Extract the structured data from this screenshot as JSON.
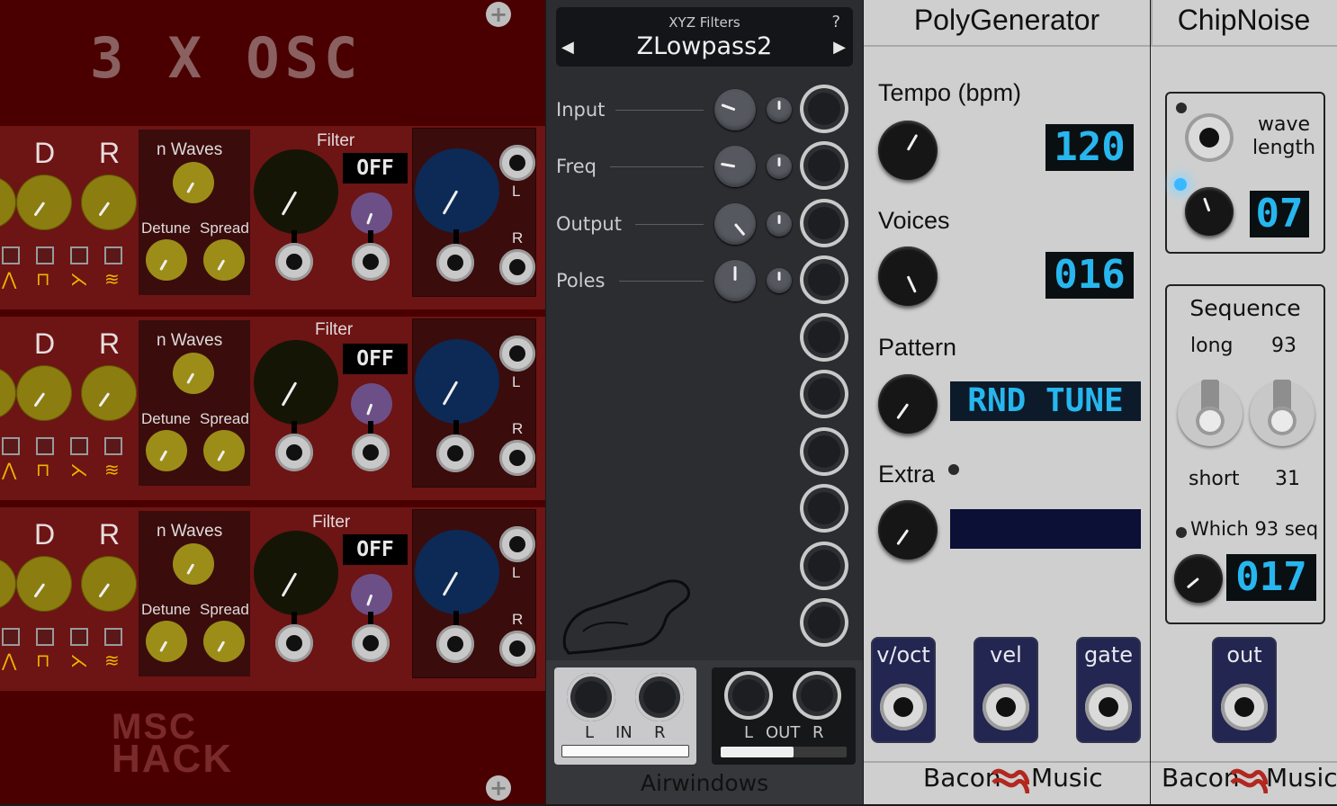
{
  "msc_hack": {
    "title": "3 X OSC",
    "brand_line1": "MSC",
    "brand_line2": "HACK",
    "screw_symbol": "+",
    "voices": [
      {
        "d_label": "D",
        "r_label": "R",
        "nwaves_label": "n Waves",
        "detune_label": "Detune",
        "spread_label": "Spread",
        "filter_label": "Filter",
        "filter_state": "OFF",
        "l_label": "L",
        "r_out_label": "R"
      },
      {
        "d_label": "D",
        "r_label": "R",
        "nwaves_label": "n Waves",
        "detune_label": "Detune",
        "spread_label": "Spread",
        "filter_label": "Filter",
        "filter_state": "OFF",
        "l_label": "L",
        "r_out_label": "R"
      },
      {
        "d_label": "D",
        "r_label": "R",
        "nwaves_label": "n Waves",
        "detune_label": "Detune",
        "spread_label": "Spread",
        "filter_label": "Filter",
        "filter_state": "OFF",
        "l_label": "L",
        "r_out_label": "R"
      }
    ],
    "wave_symbols": [
      "⋀",
      "⊓",
      "⋋",
      "≋"
    ]
  },
  "airwindows": {
    "category": "XYZ Filters",
    "plugin_name": "ZLowpass2",
    "help_symbol": "?",
    "prev_symbol": "◀",
    "next_symbol": "▶",
    "params": [
      "Input",
      "Freq",
      "Output",
      "Poles"
    ],
    "in_l": "L",
    "in_label": "IN",
    "in_r": "R",
    "out_l": "L",
    "out_label": "OUT",
    "out_r": "R",
    "brand": "Airwindows"
  },
  "polygenerator": {
    "title": "PolyGenerator",
    "tempo_label": "Tempo (bpm)",
    "tempo_value": "120",
    "voices_label": "Voices",
    "voices_value": "016",
    "pattern_label": "Pattern",
    "pattern_value": "RND TUNE",
    "extra_label": "Extra",
    "extra_value": "",
    "outputs": [
      "v/oct",
      "vel",
      "gate"
    ],
    "brand_left": "Bacon",
    "brand_right": "Music"
  },
  "chipnoise": {
    "title": "ChipNoise",
    "wave_length_line1": "wave",
    "wave_length_line2": "length",
    "wave_length_value": "07",
    "sequence_label": "Sequence",
    "long_label": "long",
    "ninety_three_label": "93",
    "short_label": "short",
    "thirty_one_label": "31",
    "which_seq_label": "Which 93 seq",
    "which_seq_value": "017",
    "out_label": "out",
    "brand_left": "Bacon",
    "brand_right": "Music"
  },
  "colors": {
    "msc_bg": "#4a0000",
    "msc_voice": "#6d1414",
    "olive_knob": "#8c7d10",
    "air_bg": "#2b2d31",
    "bacon_panel": "#cfcfcf",
    "segment_blue": "#27b6ee",
    "output_box": "#222650"
  }
}
